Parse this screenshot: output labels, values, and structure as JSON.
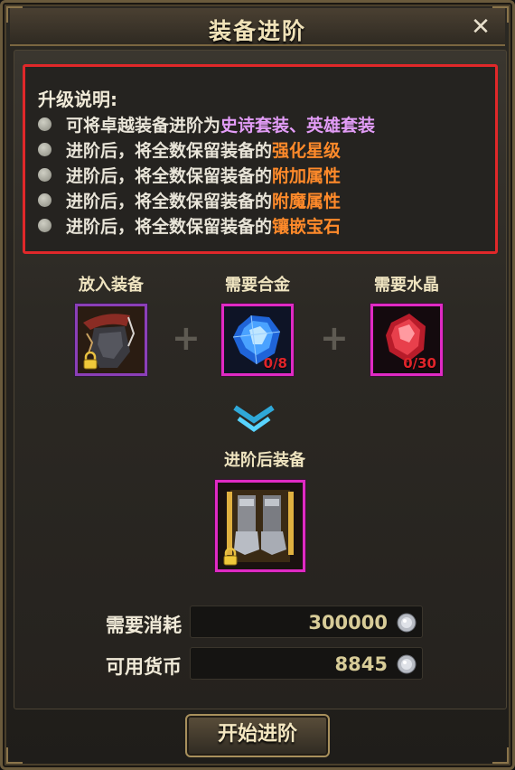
{
  "window": {
    "title": "装备进阶",
    "close_label": "✕"
  },
  "info": {
    "heading": "升级说明:",
    "lines": [
      {
        "prefix": "可将卓越装备进阶为",
        "highlight": "史诗套装、英雄套装",
        "color": "purple"
      },
      {
        "prefix": "进阶后，将全数保留装备的",
        "highlight": "强化星级",
        "color": "orange"
      },
      {
        "prefix": "进阶后，将全数保留装备的",
        "highlight": "附加属性",
        "color": "orange"
      },
      {
        "prefix": "进阶后，将全数保留装备的",
        "highlight": "附魔属性",
        "color": "orange"
      },
      {
        "prefix": "进阶后，将全数保留装备的",
        "highlight": "镶嵌宝石",
        "color": "orange"
      }
    ]
  },
  "slots": {
    "equip_label": "放入装备",
    "alloy_label": "需要合金",
    "alloy_count": "0/8",
    "crystal_label": "需要水晶",
    "crystal_count": "0/30",
    "result_label": "进阶后装备"
  },
  "cost": {
    "required_label": "需要消耗",
    "required_value": "300000",
    "available_label": "可用货币",
    "available_value": "8845"
  },
  "actions": {
    "start_label": "开始进阶"
  },
  "colors": {
    "info_border": "#e0282a",
    "highlight_purple": "#e29cf6",
    "highlight_orange": "#ff8a2a",
    "count_red": "#e0242a",
    "slot_pink": "#e02ac4",
    "slot_purple": "#8b3fb8"
  }
}
